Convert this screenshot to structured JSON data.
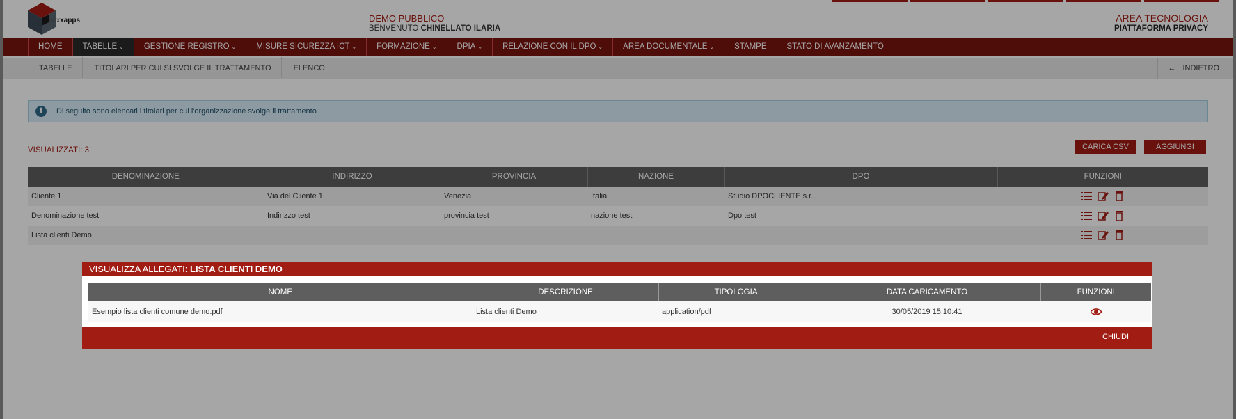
{
  "header": {
    "logo_text_a": "box",
    "logo_text_b": "xapps",
    "org": "DEMO PUBBLICO",
    "welcome_prefix": "BENVENUTO",
    "user": "CHINELLATO ILARIA",
    "area": "AREA TECNOLOGIA",
    "platform": "PIATTAFORMA PRIVACY"
  },
  "nav": {
    "items": [
      {
        "label": "HOME",
        "dropdown": false
      },
      {
        "label": "TABELLE",
        "dropdown": true,
        "active": true
      },
      {
        "label": "GESTIONE REGISTRO",
        "dropdown": true
      },
      {
        "label": "MISURE SICUREZZA ICT",
        "dropdown": true
      },
      {
        "label": "FORMAZIONE",
        "dropdown": true
      },
      {
        "label": "DPIA",
        "dropdown": true
      },
      {
        "label": "RELAZIONE CON IL DPO",
        "dropdown": true
      },
      {
        "label": "AREA DOCUMENTALE",
        "dropdown": true
      },
      {
        "label": "STAMPE",
        "dropdown": false
      },
      {
        "label": "STATO DI AVANZAMENTO",
        "dropdown": false
      }
    ]
  },
  "breadcrumb": [
    "TABELLE",
    "TITOLARI PER CUI SI SVOLGE IL TRATTAMENTO",
    "ELENCO"
  ],
  "back_label": "INDIETRO",
  "info_text": "Di seguito sono elencati i titolari per cui l'organizzazione svolge il trattamento",
  "count_label": "VISUALIZZATI: 3",
  "buttons": {
    "csv": "CARICA CSV",
    "add": "AGGIUNGI"
  },
  "table": {
    "headers": [
      "DENOMINAZIONE",
      "INDIRIZZO",
      "PROVINCIA",
      "NAZIONE",
      "DPO",
      "FUNZIONI"
    ],
    "rows": [
      {
        "denominazione": "Cliente 1",
        "indirizzo": "Via del Cliente 1",
        "provincia": "Venezia",
        "nazione": "Italia",
        "dpo": "Studio DPOCLIENTE s.r.l."
      },
      {
        "denominazione": "Denominazione test",
        "indirizzo": "Indirizzo test",
        "provincia": "provincia test",
        "nazione": "nazione test",
        "dpo": "Dpo test"
      },
      {
        "denominazione": "Lista clienti Demo",
        "indirizzo": "",
        "provincia": "",
        "nazione": "",
        "dpo": ""
      }
    ]
  },
  "modal": {
    "title_prefix": "VISUALIZZA ALLEGATI:",
    "title_name": "LISTA CLIENTI DEMO",
    "headers": [
      "NOME",
      "DESCRIZIONE",
      "TIPOLOGIA",
      "DATA CARICAMENTO",
      "FUNZIONI"
    ],
    "rows": [
      {
        "nome": "Esempio lista clienti comune demo.pdf",
        "descrizione": "Lista clienti Demo",
        "tipologia": "application/pdf",
        "data": "30/05/2019 15:10:41"
      }
    ],
    "close_label": "CHIUDI"
  },
  "colors": {
    "brand": "#a11d14",
    "nav": "#7a1510",
    "header_cell": "#5e5e5e"
  },
  "icons": [
    "list-icon",
    "edit-icon",
    "trash-icon",
    "eye-icon",
    "info-icon",
    "arrow-left-icon"
  ]
}
